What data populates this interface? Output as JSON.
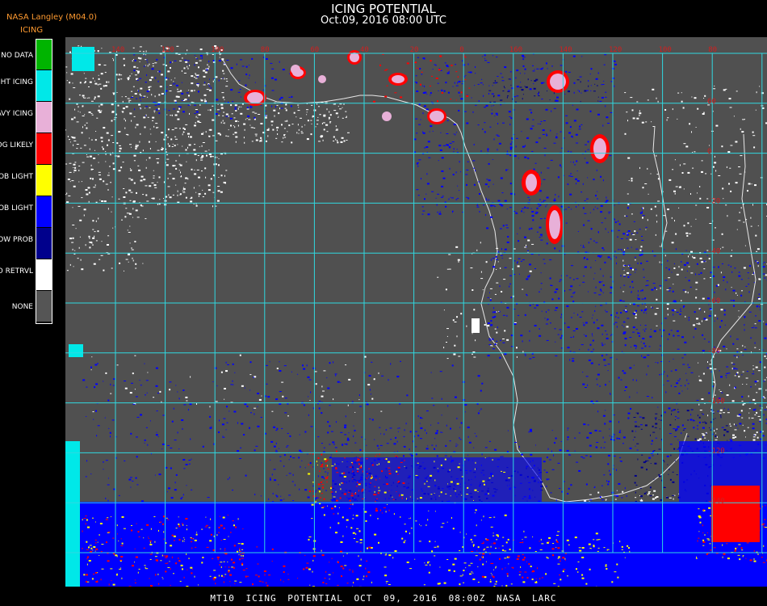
{
  "header": {
    "title": "ICING POTENTIAL",
    "subtitle": "Oct.09, 2016 08:00 UTC",
    "org": "NASA Langley (M04.0)",
    "product": "ICING"
  },
  "legend": {
    "items": [
      {
        "label": "NO DATA",
        "color": "#00b400"
      },
      {
        "label": "NIGHT ICING",
        "color": "#00e8e8"
      },
      {
        "label": "HEAVY ICING",
        "color": "#e8b0d8"
      },
      {
        "label": "MOG LIKELY",
        "color": "#ff0000"
      },
      {
        "label": "HI PROB LIGHT",
        "color": "#ffff00"
      },
      {
        "label": "LO PROB LIGHT",
        "color": "#0000ff"
      },
      {
        "label": "LOW PROB",
        "color": "#00008c"
      },
      {
        "label": "NO RETRVL",
        "color": "#ffffff"
      },
      {
        "label": "NONE",
        "color": "#555555"
      }
    ]
  },
  "map": {
    "background": "#505050",
    "grid_color": "#30d8e0",
    "border_color": "#e0e0e0",
    "top_labels": [
      "140",
      "120",
      "100",
      "80",
      "60",
      "40",
      "20",
      "0",
      "160",
      "140",
      "120",
      "100",
      "80"
    ],
    "right_labels": [
      "60",
      "0",
      "-20",
      "-40",
      "-60",
      "-80",
      "-100",
      "-120",
      "-140"
    ]
  },
  "footer": "MT10  ICING POTENTIAL   OCT 09, 2016 08:00Z   NASA LARC"
}
